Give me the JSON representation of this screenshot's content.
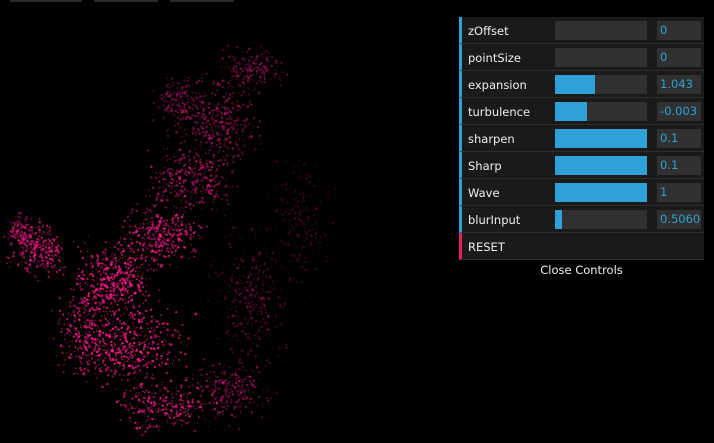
{
  "controls": [
    {
      "label": "zOffset",
      "value": "0",
      "fraction": 0
    },
    {
      "label": "pointSize",
      "value": "0",
      "fraction": 0
    },
    {
      "label": "expansion",
      "value": "1.043",
      "fraction": 0.43
    },
    {
      "label": "turbulence",
      "value": "-0.003",
      "fraction": 0.35
    },
    {
      "label": "sharpen",
      "value": "0.1",
      "fraction": 1.0
    },
    {
      "label": "Sharp",
      "value": "0.1",
      "fraction": 1.0
    },
    {
      "label": "Wave",
      "value": "1",
      "fraction": 1.0
    },
    {
      "label": "blurInput",
      "value": "0.5060",
      "fraction": 0.08
    }
  ],
  "reset_label": "RESET",
  "close_label": "Close Controls",
  "colors": {
    "accent": "#2fa1d6",
    "button_accent": "#e61d5f",
    "particle": "#ff1a8c"
  }
}
